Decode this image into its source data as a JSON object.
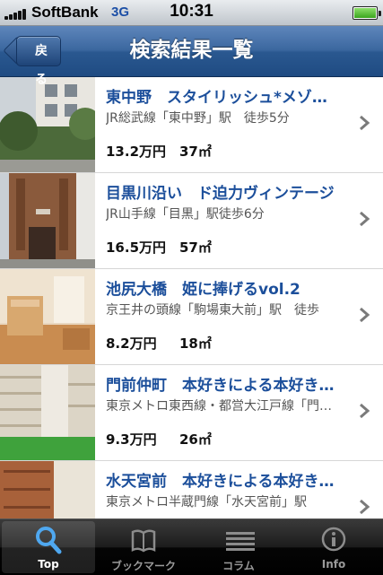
{
  "status_bar": {
    "carrier": "SoftBank",
    "network": "3G",
    "time": "10:31"
  },
  "nav": {
    "back_label": "戻る",
    "title": "検索結果一覧"
  },
  "listings": [
    {
      "title": "東中野　スタイリッシュ*メゾネット",
      "access": "JR総武線「東中野」駅　徒歩5分",
      "rent": "13.2万円",
      "area": "37㎡"
    },
    {
      "title": "目黒川沿い　ド迫力ヴィンテージ",
      "access": "JR山手線「目黒」駅徒歩6分",
      "rent": "16.5万円",
      "area": "57㎡"
    },
    {
      "title": "池尻大橋　姫に捧げるvol.2",
      "access": "京王井の頭線「駒場東大前」駅　徒歩",
      "rent": "8.2万円",
      "area": "18㎡"
    },
    {
      "title": "門前仲町　本好きによる本好きのための",
      "access": "東京メトロ東西線・都営大江戸線「門前仲町」",
      "rent": "9.3万円",
      "area": "26㎡"
    },
    {
      "title": "水天宮前　本好きによる本好きのための",
      "access": "東京メトロ半蔵門線「水天宮前」駅",
      "rent": "",
      "area": ""
    }
  ],
  "tab_bar": {
    "tabs": [
      {
        "label": "Top",
        "icon": "search-icon",
        "selected": true
      },
      {
        "label": "ブックマーク",
        "icon": "book-icon",
        "selected": false
      },
      {
        "label": "コラム",
        "icon": "list-icon",
        "selected": false
      },
      {
        "label": "Info",
        "icon": "info-icon",
        "selected": false
      }
    ]
  },
  "colors": {
    "nav_blue": "#2a5890",
    "title_blue": "#1c4f9b",
    "tab_bar_black": "#000000"
  }
}
